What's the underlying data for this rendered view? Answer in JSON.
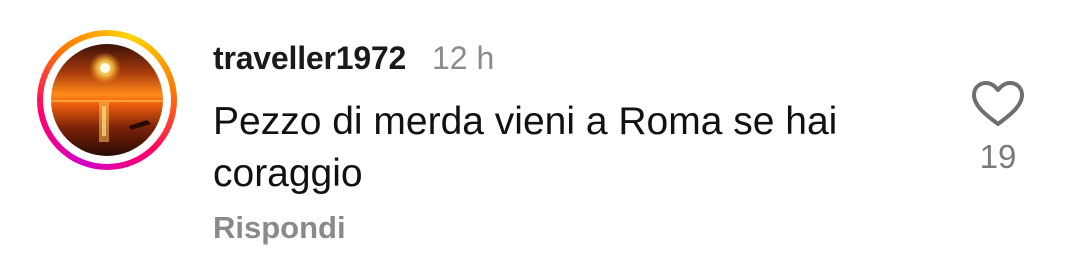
{
  "comment": {
    "username": "traveller1972",
    "time": "12 h",
    "text": "Pezzo di merda vieni a Roma se hai coraggio",
    "reply_label": "Rispondi",
    "like_icon": "heart-outline-icon",
    "like_count": "19"
  },
  "colors": {
    "text": "#000000",
    "secondary": "#8a8a8a",
    "story_ring": [
      "#d300c5",
      "#ff0069",
      "#ff7a00",
      "#ffd600"
    ]
  }
}
